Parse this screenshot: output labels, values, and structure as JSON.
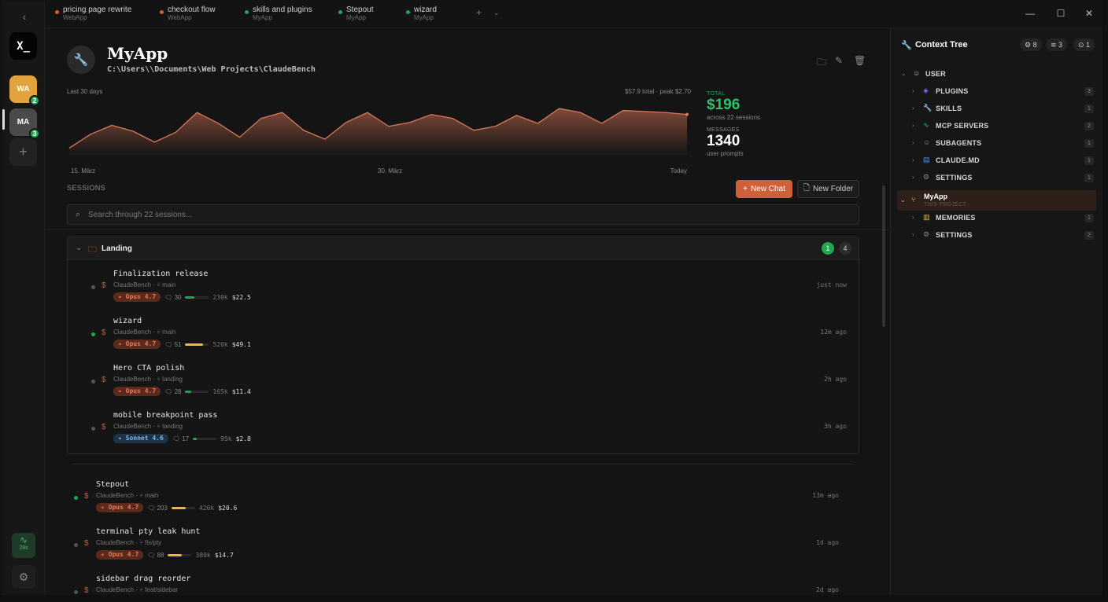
{
  "tabs": [
    {
      "title": "pricing page rewrite",
      "project": "WebApp",
      "color": "#e0583a"
    },
    {
      "title": "checkout flow",
      "project": "WebApp",
      "color": "#e0583a"
    },
    {
      "title": "skills and plugins",
      "project": "MyApp",
      "color": "#1ea94f"
    },
    {
      "title": "Stepout",
      "project": "MyApp",
      "color": "#1ea94f"
    },
    {
      "title": "wizard",
      "project": "MyApp",
      "color": "#1ea94f"
    }
  ],
  "rail": {
    "logo": "X_",
    "workspaces": [
      {
        "initials": "WA",
        "badge": "2",
        "color": "#e0a33e"
      },
      {
        "initials": "MA",
        "badge": "3",
        "color": "#4a4a4a"
      }
    ],
    "activity": "28",
    "activity_unit": "s"
  },
  "project": {
    "name": "MyApp",
    "path": "C:\\Users\\\\Documents\\Web Projects\\ClaudeBench"
  },
  "chart_data": {
    "type": "area",
    "title": "",
    "range_label": "Last 30 days",
    "summary": "$57.9 total · peak $2.70",
    "x_labels": [
      "15. März",
      "30. März",
      "Today"
    ],
    "values": [
      0.3,
      1.0,
      1.45,
      1.15,
      0.6,
      1.1,
      2.1,
      1.55,
      0.85,
      1.8,
      2.1,
      1.2,
      0.75,
      1.6,
      2.1,
      1.4,
      1.6,
      2.0,
      1.8,
      1.2,
      1.4,
      1.95,
      1.55,
      2.3,
      2.1,
      1.55,
      2.2,
      2.15,
      2.1,
      2.0
    ],
    "ylim": [
      0,
      2.7
    ],
    "color": "#d9775a"
  },
  "stats": {
    "total_label": "TOTAL",
    "total_value": "$196",
    "total_sub": "across 22 sessions",
    "messages_label": "MESSAGES",
    "messages_value": "1340",
    "messages_sub": "user prompts"
  },
  "sessions_label": "SESSIONS",
  "new_chat": "New Chat",
  "new_folder": "New Folder",
  "search_placeholder": "Search through 22 sessions...",
  "folder": {
    "name": "Landing",
    "active_count": "1",
    "total_count": "4",
    "sessions": [
      {
        "title": "Finalization release",
        "meta": "ClaudeBench · ⑂ main",
        "model": "Opus 4.7",
        "msgs": "30",
        "tokens": "230k",
        "cost": "$22.5",
        "time": "just now",
        "active": false,
        "fill": 0.4,
        "bar": "#1ea94f"
      },
      {
        "title": "wizard",
        "meta": "ClaudeBench · ⑂ main",
        "model": "Opus 4.7",
        "msgs": "51",
        "tokens": "520k",
        "cost": "$49.1",
        "time": "12m ago",
        "active": true,
        "fill": 0.75,
        "bar": "#e8b93a"
      },
      {
        "title": "Hero CTA polish",
        "meta": "ClaudeBench · ⑂ landing",
        "model": "Opus 4.7",
        "msgs": "28",
        "tokens": "165k",
        "cost": "$11.4",
        "time": "2h ago",
        "active": false,
        "fill": 0.25,
        "bar": "#1ea94f"
      },
      {
        "title": "mobile breakpoint pass",
        "meta": "ClaudeBench · ⑂ landing",
        "model": "Sonnet 4.6",
        "msgs": "17",
        "tokens": "95k",
        "cost": "$2.8",
        "time": "3h ago",
        "active": false,
        "fill": 0.15,
        "bar": "#1ea94f"
      }
    ]
  },
  "loose_sessions": [
    {
      "title": "Stepout",
      "meta": "ClaudeBench · ⑂ main",
      "model": "Opus 4.7",
      "msgs": "203",
      "tokens": "420k",
      "cost": "$20.6",
      "time": "13m ago",
      "active": true,
      "fill": 0.6,
      "bar": "#e8b93a"
    },
    {
      "title": "terminal pty leak hunt",
      "meta": "ClaudeBench · ⑂ fix/pty",
      "model": "Opus 4.7",
      "msgs": "88",
      "tokens": "380k",
      "cost": "$14.7",
      "time": "1d ago",
      "active": false,
      "fill": 0.6,
      "bar": "#e8b93a"
    },
    {
      "title": "sidebar drag reorder",
      "meta": "ClaudeBench · ⑂ feat/sidebar",
      "time": "2d ago",
      "active": false
    }
  ],
  "context": {
    "title": "Context Tree",
    "badges": [
      "8",
      "3",
      "1"
    ],
    "user_label": "USER",
    "user_items": [
      {
        "label": "PLUGINS",
        "count": "3",
        "icon": "layers-icon",
        "color": "#8b6cff"
      },
      {
        "label": "SKILLS",
        "count": "1",
        "icon": "wrench-icon",
        "color": "#d0603a"
      },
      {
        "label": "MCP SERVERS",
        "count": "2",
        "icon": "activity-icon",
        "color": "#2bb3a3"
      },
      {
        "label": "SUBAGENTS",
        "count": "1",
        "icon": "person-icon",
        "color": "#888888"
      },
      {
        "label": "CLAUDE.MD",
        "count": "1",
        "icon": "file-icon",
        "color": "#4a8fe0"
      },
      {
        "label": "SETTINGS",
        "count": "1",
        "icon": "gear-icon",
        "color": "#888888"
      }
    ],
    "project_label": "MyApp",
    "project_sub": "THIS PROJECT",
    "project_items": [
      {
        "label": "MEMORIES",
        "count": "1",
        "icon": "book-icon",
        "color": "#e8b93a"
      },
      {
        "label": "SETTINGS",
        "count": "2",
        "icon": "gear-icon",
        "color": "#888888"
      }
    ]
  }
}
